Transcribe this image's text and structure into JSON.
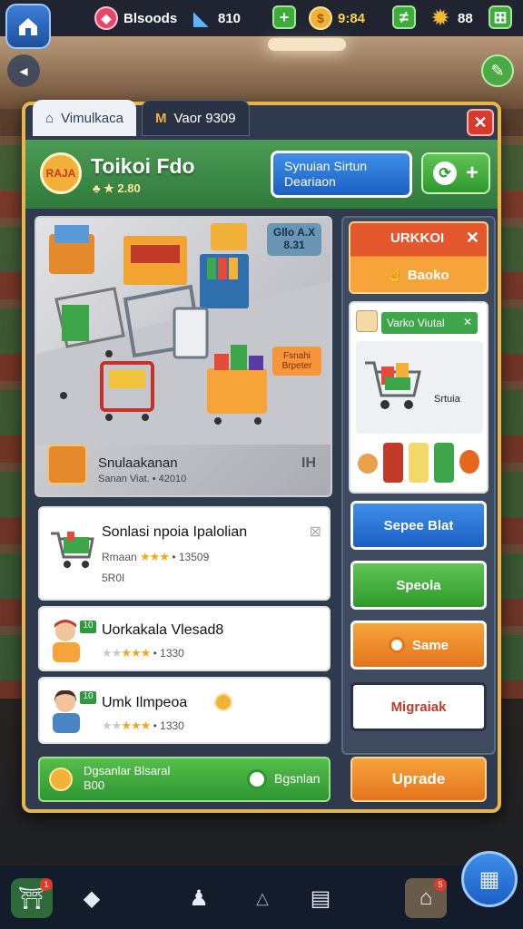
{
  "hud": {
    "gems": "Blsoods",
    "diamonds": "810",
    "coins": "9:84",
    "stars": "88"
  },
  "tabs": [
    {
      "label": "Vimulkaca"
    },
    {
      "label": "Vaor 9309"
    }
  ],
  "header": {
    "store_name": "Toikoi Fdo",
    "store_sub": "2.80",
    "store_badge": "RAJA",
    "sync_line1": "Synuian Sirtun",
    "sync_line2": "Deariaon"
  },
  "showcase": {
    "tag": "Gllo A.X 8.31",
    "promo_label": "Fsnahi Brpeter",
    "title": "Snulaakanan",
    "subtitle": "Sanan Viat. • 42010",
    "indicator": "IH"
  },
  "cards": [
    {
      "title": "Sonlasi npoia Ipalolian",
      "meta1": "Rmaan",
      "meta2": "• 13509",
      "meta3": "5R0I",
      "level": "",
      "stars": 3
    },
    {
      "title": "Uorkakala Vlesad8",
      "meta1": "",
      "meta2": "• 1330",
      "level": "10",
      "stars": 3
    },
    {
      "title": "Umk Ilmpeoa",
      "meta1": "",
      "meta2": "• 1330",
      "level": "10",
      "stars": 3
    }
  ],
  "right": {
    "deal_title": "URKKOI",
    "deal_sub": "Baoko",
    "vcard_pill": "Varko Viutal",
    "vcard_label": "Srtuia",
    "btn_blue": "Sepee Blat",
    "btn_green": "Speola",
    "btn_orange": "Same",
    "btn_white": "Migraiak"
  },
  "bottom": {
    "coin_line1": "Dgsanlar Blsaral",
    "coin_line2": "B00",
    "coin_action": "Bgsnlan",
    "upgrade": "Uprade"
  },
  "nav": {
    "badge1": "1",
    "badge2": "5"
  },
  "colors": {
    "panel_border": "#e6b64c",
    "header_green": "#3f8c48",
    "blue_button": "#1c5fc4",
    "orange_button": "#f6a33a"
  }
}
